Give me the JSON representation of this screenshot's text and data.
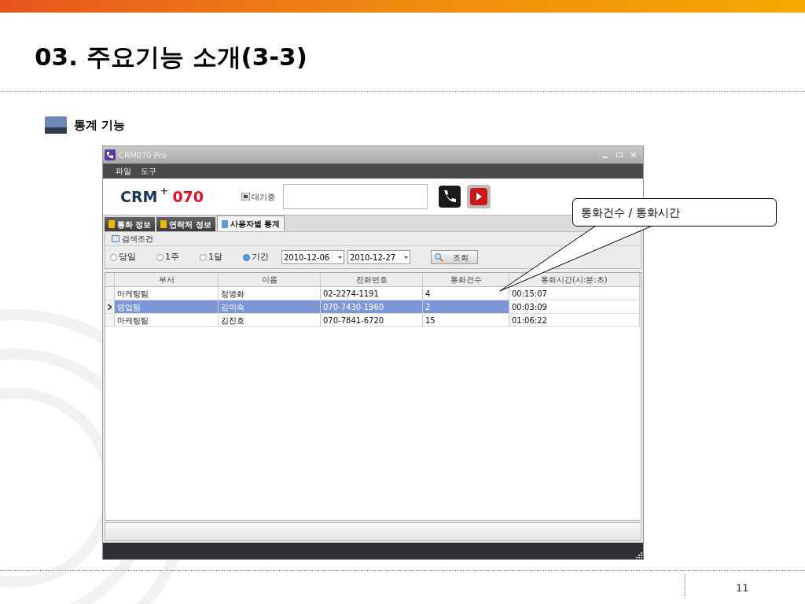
{
  "slide": {
    "title": "03. 주요기능 소개(3-3)",
    "section": "통계 기능",
    "page_number": "11"
  },
  "window": {
    "title": "CRM070 Pro",
    "menu": [
      "파일",
      "도구"
    ],
    "logo": {
      "brand": "CRM",
      "plus": "+",
      "number": "070"
    },
    "status_label": "대기중",
    "tabs": [
      {
        "label": "통화 정보",
        "selected": false
      },
      {
        "label": "연락처 정보",
        "selected": false
      },
      {
        "label": "사용자별 통계",
        "selected": true
      }
    ],
    "search_group": "검색조건",
    "periods": [
      {
        "label": "당일",
        "selected": false
      },
      {
        "label": "1주",
        "selected": false
      },
      {
        "label": "1달",
        "selected": false
      },
      {
        "label": "기간",
        "selected": true
      }
    ],
    "date_from": "2010-12-06",
    "date_to": "2010-12-27",
    "search_button": "조회",
    "table": {
      "columns": [
        "부서",
        "이름",
        "전화번호",
        "통화건수",
        "통화시간(시:분:초)"
      ],
      "rows": [
        {
          "cells": [
            "마케팅팀",
            "정병화",
            "02-2274-1191",
            "4",
            "00:15:07"
          ],
          "selected": false
        },
        {
          "cells": [
            "영업팀",
            "김미숙",
            "070-7430-1960",
            "2",
            "00:03:09"
          ],
          "selected": true
        },
        {
          "cells": [
            "마케팅팀",
            "김진호",
            "070-7841-6720",
            "15",
            "01:06:22"
          ],
          "selected": false
        }
      ]
    }
  },
  "callout": {
    "text": "통화건수 / 통화시간"
  }
}
